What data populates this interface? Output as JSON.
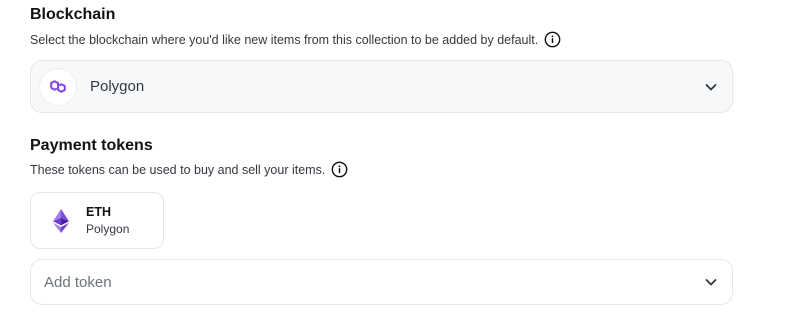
{
  "blockchain": {
    "title": "Blockchain",
    "description": "Select the blockchain where you'd like new items from this collection to be added by default.",
    "selected": "Polygon",
    "icon": "polygon-logo-icon",
    "accent_color": "#8247e5"
  },
  "payment_tokens": {
    "title": "Payment tokens",
    "description": "These tokens can be used to buy and sell your items.",
    "tokens": [
      {
        "symbol": "ETH",
        "chain": "Polygon",
        "icon": "ethereum-icon"
      }
    ],
    "add_token_placeholder": "Add token"
  },
  "icons": {
    "info": "info-circle-icon",
    "dropdown": "chevron-down-icon"
  }
}
